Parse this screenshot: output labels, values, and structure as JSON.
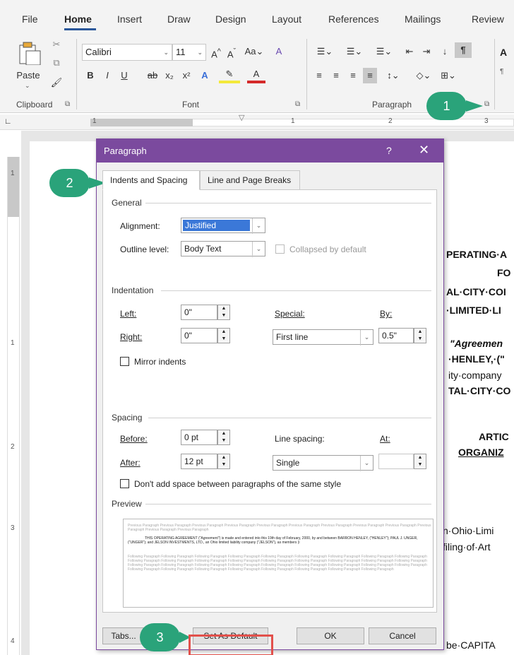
{
  "ribbon": {
    "tabs": [
      {
        "label": "File"
      },
      {
        "label": "Home"
      },
      {
        "label": "Insert"
      },
      {
        "label": "Draw"
      },
      {
        "label": "Design"
      },
      {
        "label": "Layout"
      },
      {
        "label": "References"
      },
      {
        "label": "Mailings"
      },
      {
        "label": "Review"
      }
    ],
    "paste_label": "Paste",
    "font_name": "Calibri",
    "font_size": "11",
    "aa_label": "Aa",
    "groups": {
      "clipboard": "Clipboard",
      "font": "Font",
      "paragraph": "Paragraph"
    },
    "styles_preview": "A",
    "styles_mark": "¶"
  },
  "ruler": {
    "numbers": [
      "1",
      "1",
      "2",
      "3"
    ]
  },
  "vruler": {
    "numbers": [
      "1",
      "1",
      "2",
      "3",
      "4"
    ]
  },
  "document": {
    "lines": [
      "PERATING·A",
      "FO",
      "AL·CITY·COI",
      "·LIMITED·LI",
      "\"Agreemen",
      "·HENLEY,·(\"",
      "ity·company",
      "TAL·CITY·CO",
      "ARTIC",
      "ORGANIZ",
      "n·Ohio·Limi",
      "filing·of·Art",
      "be·CAPITA"
    ]
  },
  "dialog": {
    "title": "Paragraph",
    "help": "?",
    "close": "✕",
    "tabs": [
      "Indents and Spacing",
      "Line and Page Breaks"
    ],
    "general": {
      "heading": "General",
      "alignment_label": "Alignment:",
      "alignment_value": "Justified",
      "outline_label": "Outline level:",
      "outline_value": "Body Text",
      "collapsed_label": "Collapsed by default"
    },
    "indentation": {
      "heading": "Indentation",
      "left_label": "Left:",
      "left_value": "0\"",
      "right_label": "Right:",
      "right_value": "0\"",
      "special_label": "Special:",
      "special_value": "First line",
      "by_label": "By:",
      "by_value": "0.5\"",
      "mirror_label": "Mirror indents"
    },
    "spacing": {
      "heading": "Spacing",
      "before_label": "Before:",
      "before_value": "0 pt",
      "after_label": "After:",
      "after_value": "12 pt",
      "line_spacing_label": "Line spacing:",
      "line_spacing_value": "Single",
      "at_label": "At:",
      "at_value": "",
      "dont_add_label": "Don't add space between paragraphs of the same style"
    },
    "preview": {
      "heading": "Preview",
      "prev_text": "Previous Paragraph Previous Paragraph Previous Paragraph Previous Paragraph Previous Paragraph Previous Paragraph Previous Paragraph Previous Paragraph Previous Paragraph Previous Paragraph Previous Paragraph Previous Paragraph",
      "body_text": "THIS OPERATING AGREEMENT (\"Agreement\") is made and entered into this 19th day of February, 2000, by and between BARRON HENLEY, (\"HENLEY\"); PAUL J. UNGER, (\"UNGER\"); and JELSON INVESTMENTS, LTD., an Ohio limited liability company (\"JELSON\"), as members (i",
      "follow_text": "Following Paragraph Following Paragraph Following Paragraph Following Paragraph Following Paragraph Following Paragraph Following Paragraph Following Paragraph Following Paragraph Following Paragraph Following Paragraph Following Paragraph Following Paragraph Following Paragraph Following Paragraph Following Paragraph Following Paragraph Following Paragraph Following Paragraph Following Paragraph Following Paragraph Following Paragraph Following Paragraph Following Paragraph Following Paragraph Following Paragraph Following Paragraph Following Paragraph Following Paragraph Following Paragraph Following Paragraph Following Paragraph Following Paragraph Following Paragraph Following Paragraph"
    },
    "buttons": {
      "tabs": "Tabs...",
      "set_default": "Set As Default",
      "ok": "OK",
      "cancel": "Cancel"
    }
  },
  "callouts": [
    "1",
    "2",
    "3"
  ],
  "colors": {
    "dialog_title": "#7b4a9e",
    "callout": "#2aa37a",
    "highlight": "#e2504b"
  }
}
